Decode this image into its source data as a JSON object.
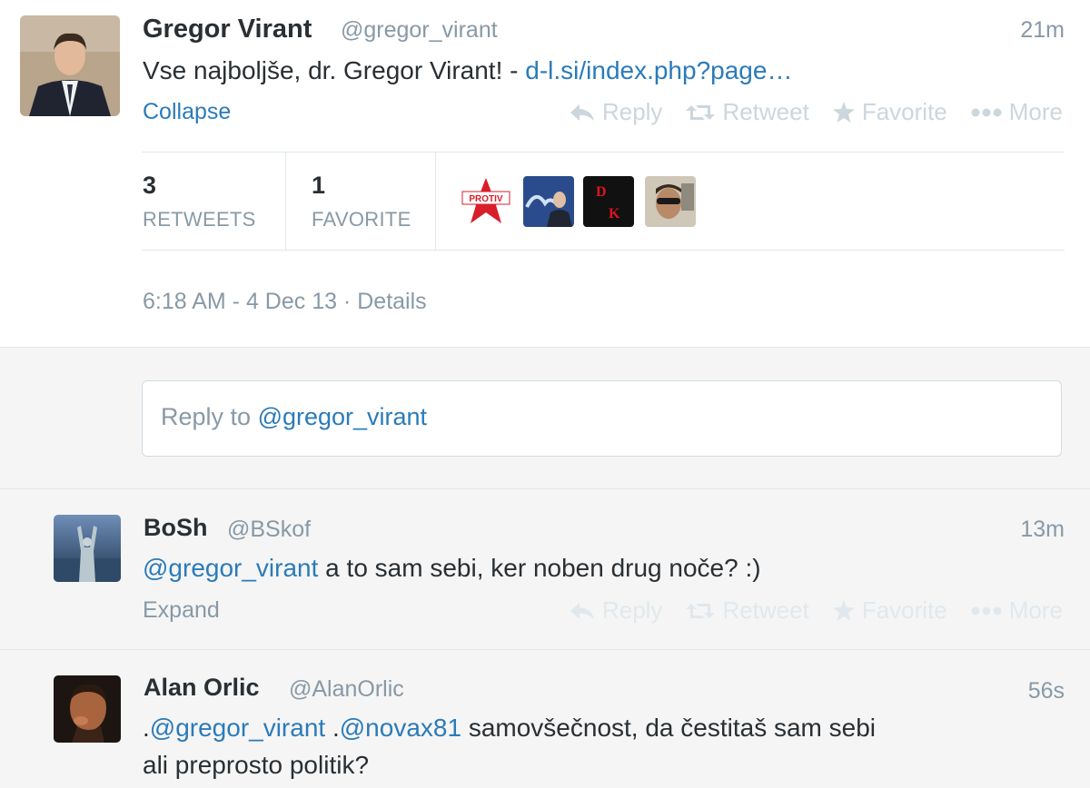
{
  "main_tweet": {
    "name": "Gregor Virant",
    "handle": "@gregor_virant",
    "time": "21m",
    "text_before": "Vse najboljše, dr. Gregor Virant! - ",
    "link": "d-l.si/index.php?page…",
    "collapse_label": "Collapse",
    "retweets_count": "3",
    "retweets_label": "RETWEETS",
    "favorites_count": "1",
    "favorites_label": "FAVORITE",
    "favoriter_badges": [
      "PROTIV",
      "D",
      "K"
    ],
    "timestamp": "6:18 AM - 4 Dec 13",
    "details_sep": " · ",
    "details_label": "Details"
  },
  "actions": {
    "reply": "Reply",
    "retweet": "Retweet",
    "favorite": "Favorite",
    "more": "More"
  },
  "reply_box": {
    "placeholder_prefix": "Reply to ",
    "mention": "@gregor_virant"
  },
  "replies": [
    {
      "name": "BoSh",
      "handle": "@BSkof",
      "time": "13m",
      "mention": "@gregor_virant",
      "text": " a to sam sebi, ker noben drug noče? :)",
      "expand_label": "Expand"
    },
    {
      "name": "Alan Orlic",
      "handle": "@AlanOrlic",
      "time": "56s",
      "prefix": ".",
      "mention1": "@gregor_virant",
      "mid": " .",
      "mention2": "@novax81",
      "text_line1": " samovšečnost, da čestitaš sam sebi",
      "text_line2": "ali preprosto politik?"
    }
  ],
  "colors": {
    "link": "#2b7bb9",
    "muted": "#8899a6",
    "text": "#292f33",
    "background": "#f5f5f5"
  }
}
